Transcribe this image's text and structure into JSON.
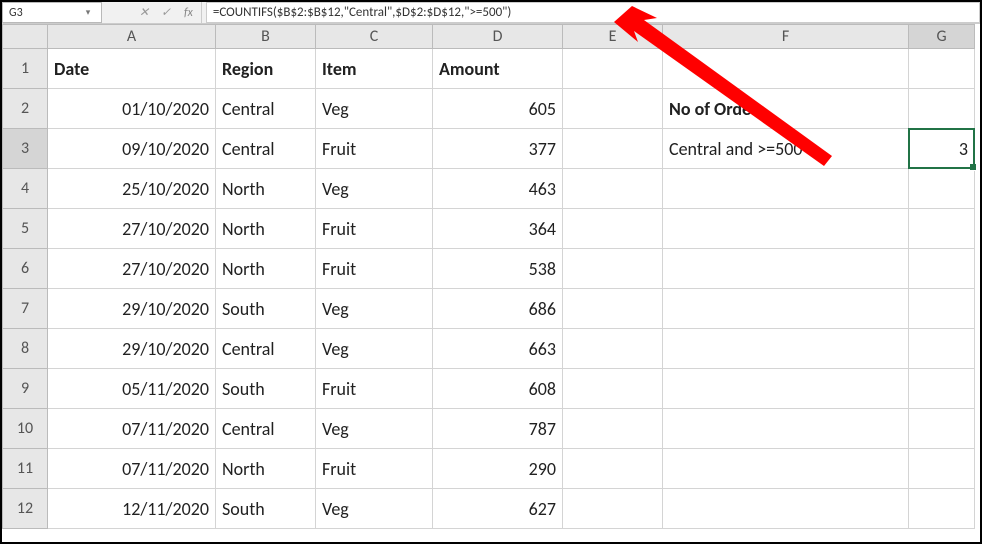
{
  "formula_bar": {
    "name_box": "G3",
    "formula": "=COUNTIFS($B$2:$B$12,\"Central\",$D$2:$D$12,\">=500\")"
  },
  "columns": [
    "A",
    "B",
    "C",
    "D",
    "E",
    "F",
    "G"
  ],
  "row_numbers": [
    "1",
    "2",
    "3",
    "4",
    "5",
    "6",
    "7",
    "8",
    "9",
    "10",
    "11",
    "12"
  ],
  "headers": {
    "date": "Date",
    "region": "Region",
    "item": "Item",
    "amount": "Amount"
  },
  "side": {
    "title": "No of Orders",
    "label": "Central and >=500",
    "result": "3"
  },
  "rows": [
    {
      "date": "01/10/2020",
      "region": "Central",
      "item": "Veg",
      "amount": "605"
    },
    {
      "date": "09/10/2020",
      "region": "Central",
      "item": "Fruit",
      "amount": "377"
    },
    {
      "date": "25/10/2020",
      "region": "North",
      "item": "Veg",
      "amount": "463"
    },
    {
      "date": "27/10/2020",
      "region": "North",
      "item": "Fruit",
      "amount": "364"
    },
    {
      "date": "27/10/2020",
      "region": "North",
      "item": "Fruit",
      "amount": "538"
    },
    {
      "date": "29/10/2020",
      "region": "South",
      "item": "Veg",
      "amount": "686"
    },
    {
      "date": "29/10/2020",
      "region": "Central",
      "item": "Veg",
      "amount": "663"
    },
    {
      "date": "05/11/2020",
      "region": "South",
      "item": "Fruit",
      "amount": "608"
    },
    {
      "date": "07/11/2020",
      "region": "Central",
      "item": "Veg",
      "amount": "787"
    },
    {
      "date": "07/11/2020",
      "region": "North",
      "item": "Fruit",
      "amount": "290"
    },
    {
      "date": "12/11/2020",
      "region": "South",
      "item": "Veg",
      "amount": "627"
    }
  ]
}
